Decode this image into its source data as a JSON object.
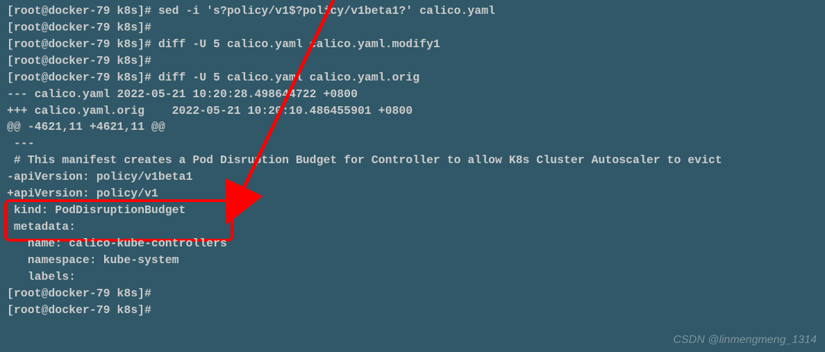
{
  "lines": [
    "[root@docker-79 k8s]# sed -i 's?policy/v1$?policy/v1beta1?' calico.yaml",
    "[root@docker-79 k8s]#",
    "[root@docker-79 k8s]# diff -U 5 calico.yaml calico.yaml.modify1",
    "[root@docker-79 k8s]#",
    "[root@docker-79 k8s]# diff -U 5 calico.yaml calico.yaml.orig",
    "--- calico.yaml 2022-05-21 10:20:28.498644722 +0800",
    "+++ calico.yaml.orig    2022-05-21 10:20:10.486455901 +0800",
    "@@ -4621,11 +4621,11 @@",
    "",
    " ---",
    "",
    " # This manifest creates a Pod Disruption Budget for Controller to allow K8s Cluster Autoscaler to evict",
    "",
    "-apiVersion: policy/v1beta1",
    "+apiVersion: policy/v1",
    " kind: PodDisruptionBudget",
    " metadata:",
    "   name: calico-kube-controllers",
    "   namespace: kube-system",
    "   labels:",
    "[root@docker-79 k8s]#",
    "[root@docker-79 k8s]#"
  ],
  "watermark": "CSDN @linmengmeng_1314"
}
